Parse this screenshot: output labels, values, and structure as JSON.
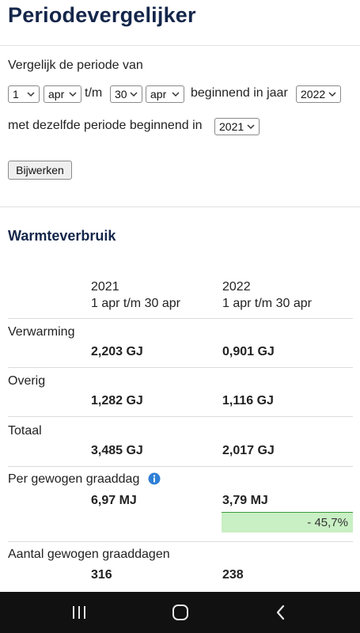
{
  "title": "Periodevergelijker",
  "compare_label": "Vergelijk de periode van",
  "selects": {
    "day_from": "1",
    "month_from": "apr",
    "tm": "t/m",
    "day_to": "30",
    "month_to": "apr",
    "year_label": "beginnend in jaar",
    "year": "2022",
    "same_period_label": "met dezelfde periode beginnend in",
    "compare_year": "2021"
  },
  "update_button": "Bijwerken",
  "section_title": "Warmteverbruik",
  "columns": [
    {
      "year": "2021",
      "range": "1 apr t/m 30 apr"
    },
    {
      "year": "2022",
      "range": "1 apr t/m 30 apr"
    }
  ],
  "rows": [
    {
      "label": "Verwarming",
      "v2021": "2,203 GJ",
      "v2022": "0,901 GJ"
    },
    {
      "label": "Overig",
      "v2021": "1,282 GJ",
      "v2022": "1,116 GJ"
    },
    {
      "label": "Totaal",
      "v2021": "3,485 GJ",
      "v2022": "2,017 GJ"
    },
    {
      "label": "Per gewogen graaddag",
      "v2021": "6,97 MJ",
      "v2022": "3,79 MJ",
      "change": "- 45,7%"
    },
    {
      "label": "Aantal gewogen graaddagen",
      "v2021": "316",
      "v2022": "238"
    }
  ],
  "icons": {
    "info": "info-icon",
    "recents": "recents-icon",
    "home": "home-icon",
    "back": "back-icon"
  },
  "colors": {
    "heading": "#14264a",
    "positive_bg": "#c9efc4",
    "info": "#2f7fd6"
  }
}
